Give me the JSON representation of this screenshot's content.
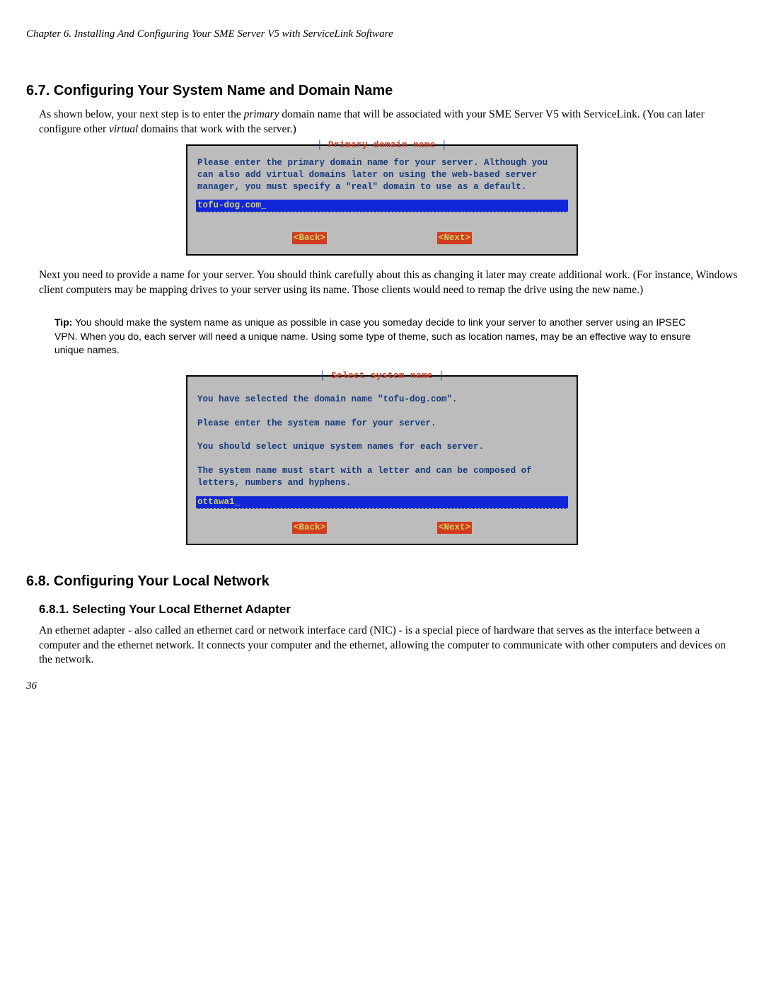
{
  "chapter_header": "Chapter 6. Installing And Configuring Your SME Server V5 with ServiceLink Software",
  "section_67": {
    "heading": "6.7. Configuring Your System Name and Domain Name",
    "para1_a": "As shown below, your next step is to enter the ",
    "para1_em1": "primary",
    "para1_b": " domain name that will be associated with your SME Server V5 with ServiceLink. (You can later configure other ",
    "para1_em2": "virtual",
    "para1_c": " domains that work with the server.)",
    "para2": "Next you need to provide a name for your server. You should think carefully about this as changing it later may create additional work. (For instance, Windows client computers may be mapping drives to your server using its name. Those clients would need to remap the drive using the new name.)"
  },
  "tip": {
    "label": "Tip:",
    "text": " You should make the system name as unique as possible in case you someday decide to link your server to another server using an IPSEC VPN. When you do, each server will need a unique name. Using some type of theme, such as location names, may be an effective way to ensure unique names."
  },
  "console1": {
    "title": "Primary domain name",
    "body": "Please enter the primary domain name for your server. Although you can also add virtual domains later on using the web-based server manager, you must specify a \"real\" domain to use as a default.",
    "input": "tofu-dog.com",
    "back": "<Back>",
    "next": "<Next>"
  },
  "console2": {
    "title": "Select system name",
    "body": "You have selected the domain name \"tofu-dog.com\".\n\nPlease enter the system name for your server.\n\nYou should select unique system names for each server.\n\nThe system name must start with a letter and can be composed of letters, numbers and hyphens.",
    "input": "ottawa1",
    "back": "<Back>",
    "next": "<Next>"
  },
  "section_68": {
    "heading": "6.8. Configuring Your Local Network",
    "sub_heading": "6.8.1. Selecting Your Local Ethernet Adapter",
    "para": "An ethernet adapter - also called an ethernet card or network interface card (NIC) - is a special piece of hardware that serves as the interface between a computer and the ethernet network. It connects your computer and the ethernet, allowing the computer to communicate with other computers and devices on the network."
  },
  "page_number": "36"
}
